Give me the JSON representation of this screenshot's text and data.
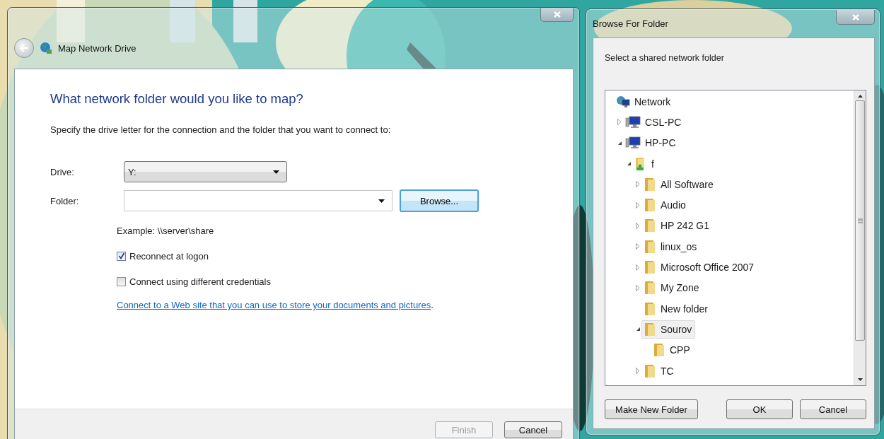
{
  "main_window": {
    "title": "Map Network Drive",
    "heading": "What network folder would you like to map?",
    "instruction": "Specify the drive letter for the connection and the folder that you want to connect to:",
    "drive": {
      "label": "Drive:",
      "value": "Y:"
    },
    "folder": {
      "label": "Folder:"
    },
    "browse_button": "Browse...",
    "example": "Example: \\\\server\\share",
    "options": [
      {
        "label": "Reconnect at logon",
        "checked": true
      },
      {
        "label": "Connect using different credentials",
        "checked": false
      }
    ],
    "link": "Connect to a Web site that you can use to store your documents and pictures",
    "link_end": ".",
    "buttons": [
      {
        "label": "Finish",
        "disabled": true
      },
      {
        "label": "Cancel",
        "disabled": false
      }
    ]
  },
  "browse_window": {
    "title": "Browse For Folder",
    "prompt": "Select a shared network folder",
    "tree": [
      {
        "label": "Network",
        "kind": "network",
        "selected": false,
        "children": [
          {
            "label": "CSL-PC",
            "kind": "computer",
            "expanded": false,
            "selected": false
          },
          {
            "label": "HP-PC",
            "kind": "computer",
            "expanded": true,
            "selected": false,
            "children": [
              {
                "label": "f",
                "kind": "share",
                "expanded": true,
                "selected": false,
                "children": [
                  {
                    "label": "All Software",
                    "kind": "folder",
                    "expanded": false,
                    "selected": false
                  },
                  {
                    "label": "Audio",
                    "kind": "folder",
                    "expanded": false,
                    "selected": false
                  },
                  {
                    "label": "HP 242 G1",
                    "kind": "folder",
                    "expanded": false,
                    "selected": false
                  },
                  {
                    "label": "linux_os",
                    "kind": "folder",
                    "expanded": false,
                    "selected": false
                  },
                  {
                    "label": "Microsoft Office 2007",
                    "kind": "folder",
                    "expanded": false,
                    "selected": false
                  },
                  {
                    "label": "My Zone",
                    "kind": "folder",
                    "expanded": false,
                    "selected": false
                  },
                  {
                    "label": "New folder",
                    "kind": "folder",
                    "selected": false
                  },
                  {
                    "label": "Sourov",
                    "kind": "folder",
                    "expanded": true,
                    "selected": true,
                    "children": [
                      {
                        "label": "CPP",
                        "kind": "folder",
                        "selected": false
                      }
                    ]
                  },
                  {
                    "label": "TC",
                    "kind": "folder",
                    "expanded": false,
                    "selected": false
                  }
                ]
              }
            ]
          }
        ]
      }
    ],
    "buttons": [
      "Make New Folder",
      "OK",
      "Cancel"
    ]
  }
}
